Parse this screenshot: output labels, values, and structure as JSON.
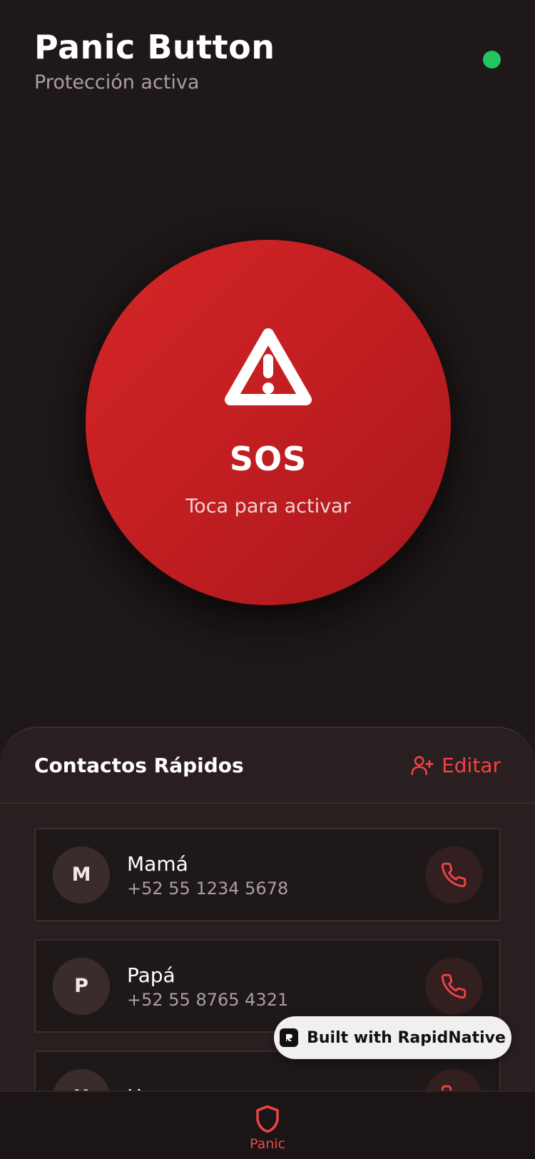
{
  "header": {
    "title": "Panic Button",
    "subtitle": "Protección activa",
    "status_color": "#22c55e"
  },
  "sos": {
    "label": "SOS",
    "hint": "Toca para activar",
    "icon": "warning-triangle-icon",
    "color": "#d42626"
  },
  "contacts": {
    "title": "Contactos Rápidos",
    "edit_label": "Editar",
    "edit_icon": "user-plus-icon",
    "items": [
      {
        "initial": "M",
        "name": "Mamá",
        "phone": "+52 55 1234 5678"
      },
      {
        "initial": "P",
        "name": "Papá",
        "phone": "+52 55 8765 4321"
      },
      {
        "initial": "H",
        "name": "Hermano",
        "phone": ""
      }
    ],
    "call_icon": "phone-icon"
  },
  "badge": {
    "label": "Built with RapidNative"
  },
  "tabbar": {
    "items": [
      {
        "label": "Panic",
        "icon": "shield-icon",
        "active": true
      }
    ],
    "accent": "#ef4444"
  }
}
